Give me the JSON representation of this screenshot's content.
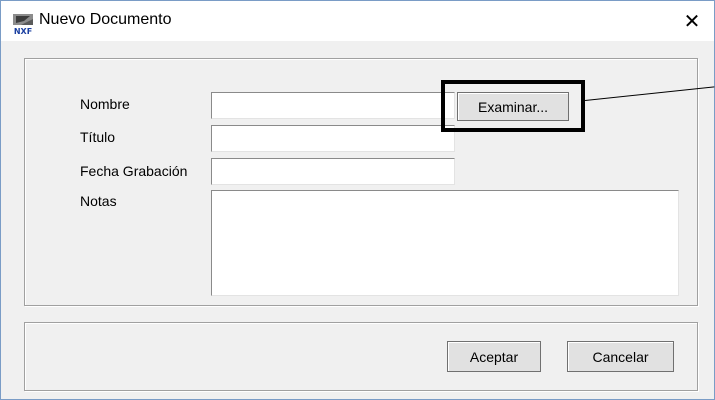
{
  "window": {
    "title": "Nuevo Documento",
    "icon": "nxf-app-icon",
    "icon_text": "NXF",
    "close_label": "✕"
  },
  "form": {
    "nombre_label": "Nombre",
    "nombre_value": "",
    "examinar_label": "Examinar...",
    "titulo_label": "Título",
    "titulo_value": "",
    "fecha_label": "Fecha Grabación",
    "fecha_value": "",
    "notas_label": "Notas",
    "notas_value": ""
  },
  "footer": {
    "accept_label": "Aceptar",
    "cancel_label": "Cancelar"
  },
  "colors": {
    "dialog_bg": "#f0f0f0",
    "titlebar_bg": "#ffffff",
    "border": "#7a9cc6",
    "highlight": "#000000"
  }
}
